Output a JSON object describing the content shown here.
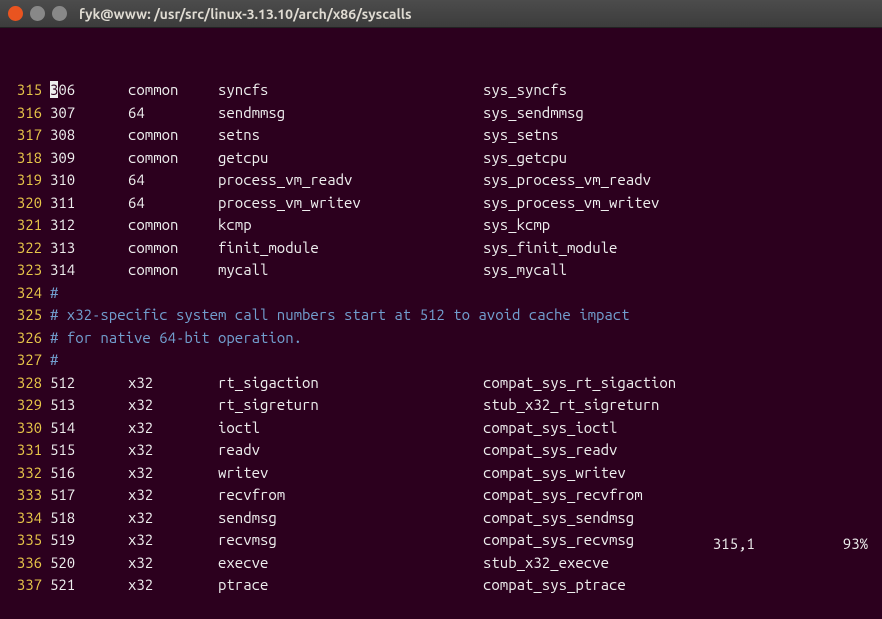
{
  "window": {
    "title": "fyk@www: /usr/src/linux-3.13.10/arch/x86/syscalls"
  },
  "rows": [
    {
      "ln": "315",
      "num": "306",
      "abi": "common",
      "name": "syncfs",
      "entry": "sys_syncfs"
    },
    {
      "ln": "316",
      "num": "307",
      "abi": "64",
      "name": "sendmmsg",
      "entry": "sys_sendmmsg"
    },
    {
      "ln": "317",
      "num": "308",
      "abi": "common",
      "name": "setns",
      "entry": "sys_setns"
    },
    {
      "ln": "318",
      "num": "309",
      "abi": "common",
      "name": "getcpu",
      "entry": "sys_getcpu"
    },
    {
      "ln": "319",
      "num": "310",
      "abi": "64",
      "name": "process_vm_readv",
      "entry": "sys_process_vm_readv"
    },
    {
      "ln": "320",
      "num": "311",
      "abi": "64",
      "name": "process_vm_writev",
      "entry": "sys_process_vm_writev"
    },
    {
      "ln": "321",
      "num": "312",
      "abi": "common",
      "name": "kcmp",
      "entry": "sys_kcmp"
    },
    {
      "ln": "322",
      "num": "313",
      "abi": "common",
      "name": "finit_module",
      "entry": "sys_finit_module"
    },
    {
      "ln": "323",
      "num": "314",
      "abi": "common",
      "name": "mycall",
      "entry": "sys_mycall"
    }
  ],
  "comments": [
    {
      "ln": "324",
      "text": "#"
    },
    {
      "ln": "325",
      "text": "# x32-specific system call numbers start at 512 to avoid cache impact"
    },
    {
      "ln": "326",
      "text": "# for native 64-bit operation."
    },
    {
      "ln": "327",
      "text": "#"
    }
  ],
  "rows2": [
    {
      "ln": "328",
      "num": "512",
      "abi": "x32",
      "name": "rt_sigaction",
      "entry": "compat_sys_rt_sigaction"
    },
    {
      "ln": "329",
      "num": "513",
      "abi": "x32",
      "name": "rt_sigreturn",
      "entry": "stub_x32_rt_sigreturn"
    },
    {
      "ln": "330",
      "num": "514",
      "abi": "x32",
      "name": "ioctl",
      "entry": "compat_sys_ioctl"
    },
    {
      "ln": "331",
      "num": "515",
      "abi": "x32",
      "name": "readv",
      "entry": "compat_sys_readv"
    },
    {
      "ln": "332",
      "num": "516",
      "abi": "x32",
      "name": "writev",
      "entry": "compat_sys_writev"
    },
    {
      "ln": "333",
      "num": "517",
      "abi": "x32",
      "name": "recvfrom",
      "entry": "compat_sys_recvfrom"
    },
    {
      "ln": "334",
      "num": "518",
      "abi": "x32",
      "name": "sendmsg",
      "entry": "compat_sys_sendmsg"
    },
    {
      "ln": "335",
      "num": "519",
      "abi": "x32",
      "name": "recvmsg",
      "entry": "compat_sys_recvmsg"
    },
    {
      "ln": "336",
      "num": "520",
      "abi": "x32",
      "name": "execve",
      "entry": "stub_x32_execve"
    },
    {
      "ln": "337",
      "num": "521",
      "abi": "x32",
      "name": "ptrace",
      "entry": "compat_sys_ptrace"
    }
  ],
  "status": {
    "position": "315,1",
    "percent": "93%"
  },
  "cursor": {
    "first_char": "3",
    "rest": "06"
  }
}
